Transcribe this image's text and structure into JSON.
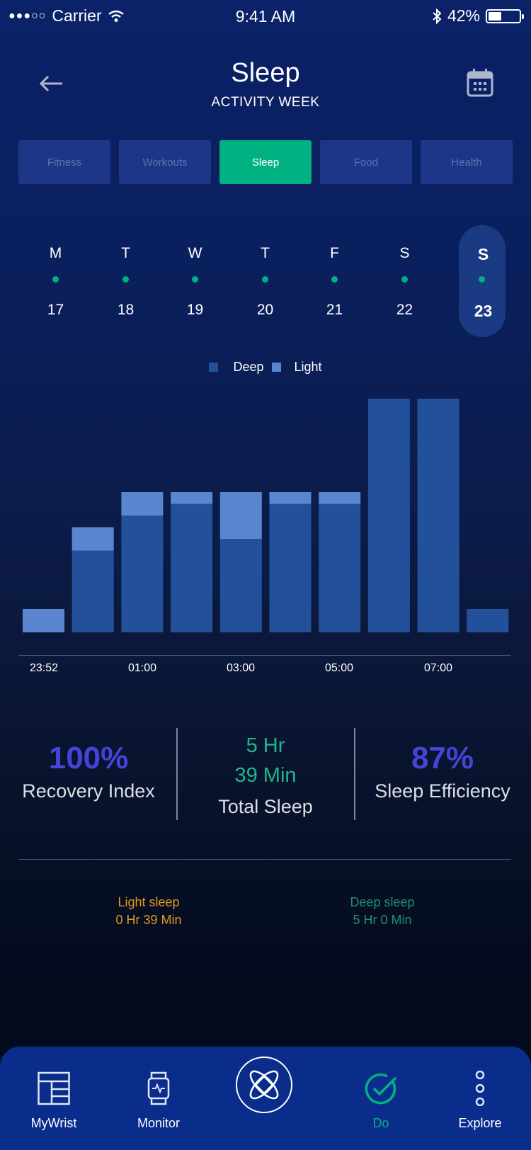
{
  "status_bar": {
    "carrier": "Carrier",
    "time": "9:41 AM",
    "battery": "42%",
    "battery_level": 0.42
  },
  "header": {
    "title": "Sleep",
    "subtitle": "ACTIVITY WEEK"
  },
  "tabs": [
    {
      "label": "Fitness",
      "active": false
    },
    {
      "label": "Workouts",
      "active": false
    },
    {
      "label": "Sleep",
      "active": true
    },
    {
      "label": "Food",
      "active": false
    },
    {
      "label": "Health",
      "active": false
    }
  ],
  "days": [
    {
      "letter": "M",
      "date": "17",
      "active": false
    },
    {
      "letter": "T",
      "date": "18",
      "active": false
    },
    {
      "letter": "W",
      "date": "19",
      "active": false
    },
    {
      "letter": "T",
      "date": "20",
      "active": false
    },
    {
      "letter": "F",
      "date": "21",
      "active": false
    },
    {
      "letter": "S",
      "date": "22",
      "active": false
    },
    {
      "letter": "S",
      "date": "23",
      "active": true
    }
  ],
  "chart_data": {
    "type": "bar",
    "stacked": true,
    "categories": [
      "1",
      "2",
      "3",
      "4",
      "5",
      "6",
      "7",
      "8",
      "9",
      "10"
    ],
    "series": [
      {
        "name": "Deep",
        "color": "#22509b",
        "values": [
          0,
          7,
          10,
          11,
          8,
          11,
          11,
          20,
          20,
          2
        ]
      },
      {
        "name": "Light",
        "color": "#5a86cf",
        "values": [
          2,
          2,
          2,
          1,
          4,
          1,
          1,
          0,
          0,
          0
        ]
      }
    ],
    "x_tick_labels": [
      "23:52",
      "01:00",
      "03:00",
      "05:00",
      "07:00"
    ],
    "ylim": [
      0,
      20
    ],
    "grid": false,
    "legend": "top-center"
  },
  "stats": {
    "recovery": {
      "value": "100%",
      "label": "Recovery Index"
    },
    "total": {
      "hours": "5 Hr",
      "minutes": "39 Min",
      "label": "Total Sleep"
    },
    "efficiency": {
      "value": "87%",
      "label": "Sleep Efficiency"
    }
  },
  "breakdown": {
    "light": {
      "label": "Light sleep",
      "value": "0 Hr 39 Min",
      "color": "#e19a1c"
    },
    "deep": {
      "label": "Deep sleep",
      "value": "5 Hr 0 Min",
      "color": "#1f8f70"
    }
  },
  "nav": [
    {
      "label": "MyWrist",
      "icon": "dashboard-icon",
      "active": false
    },
    {
      "label": "Monitor",
      "icon": "watch-icon",
      "active": false
    },
    {
      "label": "Do",
      "icon": "check-circle-icon",
      "active": true
    },
    {
      "label": "Explore",
      "icon": "more-vertical-icon",
      "active": false
    }
  ],
  "colors": {
    "accent_green": "#00b282",
    "accent_purple": "#4444d6",
    "nav_bg": "#0a2d8c"
  }
}
